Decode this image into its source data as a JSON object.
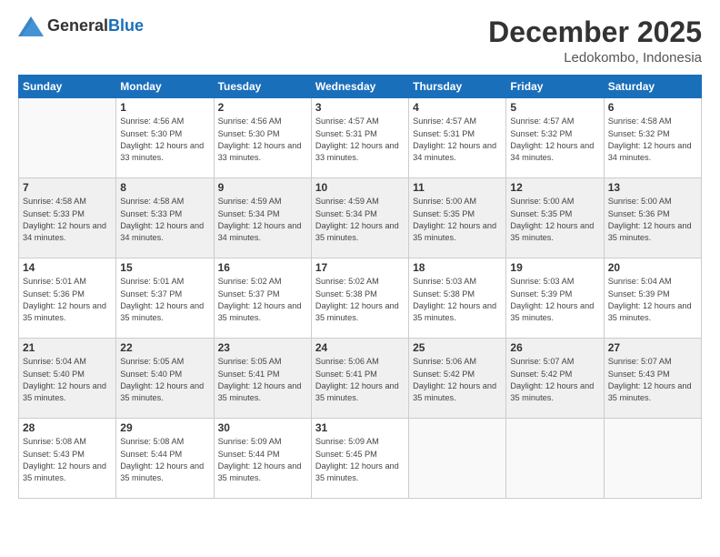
{
  "header": {
    "logo": {
      "general": "General",
      "blue": "Blue"
    },
    "title": "December 2025",
    "subtitle": "Ledokombo, Indonesia"
  },
  "calendar": {
    "headers": [
      "Sunday",
      "Monday",
      "Tuesday",
      "Wednesday",
      "Thursday",
      "Friday",
      "Saturday"
    ],
    "rows": [
      [
        {
          "date": "",
          "sunrise": "",
          "sunset": "",
          "daylight": ""
        },
        {
          "date": "1",
          "sunrise": "Sunrise: 4:56 AM",
          "sunset": "Sunset: 5:30 PM",
          "daylight": "Daylight: 12 hours and 33 minutes."
        },
        {
          "date": "2",
          "sunrise": "Sunrise: 4:56 AM",
          "sunset": "Sunset: 5:30 PM",
          "daylight": "Daylight: 12 hours and 33 minutes."
        },
        {
          "date": "3",
          "sunrise": "Sunrise: 4:57 AM",
          "sunset": "Sunset: 5:31 PM",
          "daylight": "Daylight: 12 hours and 33 minutes."
        },
        {
          "date": "4",
          "sunrise": "Sunrise: 4:57 AM",
          "sunset": "Sunset: 5:31 PM",
          "daylight": "Daylight: 12 hours and 34 minutes."
        },
        {
          "date": "5",
          "sunrise": "Sunrise: 4:57 AM",
          "sunset": "Sunset: 5:32 PM",
          "daylight": "Daylight: 12 hours and 34 minutes."
        },
        {
          "date": "6",
          "sunrise": "Sunrise: 4:58 AM",
          "sunset": "Sunset: 5:32 PM",
          "daylight": "Daylight: 12 hours and 34 minutes."
        }
      ],
      [
        {
          "date": "7",
          "sunrise": "Sunrise: 4:58 AM",
          "sunset": "Sunset: 5:33 PM",
          "daylight": "Daylight: 12 hours and 34 minutes."
        },
        {
          "date": "8",
          "sunrise": "Sunrise: 4:58 AM",
          "sunset": "Sunset: 5:33 PM",
          "daylight": "Daylight: 12 hours and 34 minutes."
        },
        {
          "date": "9",
          "sunrise": "Sunrise: 4:59 AM",
          "sunset": "Sunset: 5:34 PM",
          "daylight": "Daylight: 12 hours and 34 minutes."
        },
        {
          "date": "10",
          "sunrise": "Sunrise: 4:59 AM",
          "sunset": "Sunset: 5:34 PM",
          "daylight": "Daylight: 12 hours and 35 minutes."
        },
        {
          "date": "11",
          "sunrise": "Sunrise: 5:00 AM",
          "sunset": "Sunset: 5:35 PM",
          "daylight": "Daylight: 12 hours and 35 minutes."
        },
        {
          "date": "12",
          "sunrise": "Sunrise: 5:00 AM",
          "sunset": "Sunset: 5:35 PM",
          "daylight": "Daylight: 12 hours and 35 minutes."
        },
        {
          "date": "13",
          "sunrise": "Sunrise: 5:00 AM",
          "sunset": "Sunset: 5:36 PM",
          "daylight": "Daylight: 12 hours and 35 minutes."
        }
      ],
      [
        {
          "date": "14",
          "sunrise": "Sunrise: 5:01 AM",
          "sunset": "Sunset: 5:36 PM",
          "daylight": "Daylight: 12 hours and 35 minutes."
        },
        {
          "date": "15",
          "sunrise": "Sunrise: 5:01 AM",
          "sunset": "Sunset: 5:37 PM",
          "daylight": "Daylight: 12 hours and 35 minutes."
        },
        {
          "date": "16",
          "sunrise": "Sunrise: 5:02 AM",
          "sunset": "Sunset: 5:37 PM",
          "daylight": "Daylight: 12 hours and 35 minutes."
        },
        {
          "date": "17",
          "sunrise": "Sunrise: 5:02 AM",
          "sunset": "Sunset: 5:38 PM",
          "daylight": "Daylight: 12 hours and 35 minutes."
        },
        {
          "date": "18",
          "sunrise": "Sunrise: 5:03 AM",
          "sunset": "Sunset: 5:38 PM",
          "daylight": "Daylight: 12 hours and 35 minutes."
        },
        {
          "date": "19",
          "sunrise": "Sunrise: 5:03 AM",
          "sunset": "Sunset: 5:39 PM",
          "daylight": "Daylight: 12 hours and 35 minutes."
        },
        {
          "date": "20",
          "sunrise": "Sunrise: 5:04 AM",
          "sunset": "Sunset: 5:39 PM",
          "daylight": "Daylight: 12 hours and 35 minutes."
        }
      ],
      [
        {
          "date": "21",
          "sunrise": "Sunrise: 5:04 AM",
          "sunset": "Sunset: 5:40 PM",
          "daylight": "Daylight: 12 hours and 35 minutes."
        },
        {
          "date": "22",
          "sunrise": "Sunrise: 5:05 AM",
          "sunset": "Sunset: 5:40 PM",
          "daylight": "Daylight: 12 hours and 35 minutes."
        },
        {
          "date": "23",
          "sunrise": "Sunrise: 5:05 AM",
          "sunset": "Sunset: 5:41 PM",
          "daylight": "Daylight: 12 hours and 35 minutes."
        },
        {
          "date": "24",
          "sunrise": "Sunrise: 5:06 AM",
          "sunset": "Sunset: 5:41 PM",
          "daylight": "Daylight: 12 hours and 35 minutes."
        },
        {
          "date": "25",
          "sunrise": "Sunrise: 5:06 AM",
          "sunset": "Sunset: 5:42 PM",
          "daylight": "Daylight: 12 hours and 35 minutes."
        },
        {
          "date": "26",
          "sunrise": "Sunrise: 5:07 AM",
          "sunset": "Sunset: 5:42 PM",
          "daylight": "Daylight: 12 hours and 35 minutes."
        },
        {
          "date": "27",
          "sunrise": "Sunrise: 5:07 AM",
          "sunset": "Sunset: 5:43 PM",
          "daylight": "Daylight: 12 hours and 35 minutes."
        }
      ],
      [
        {
          "date": "28",
          "sunrise": "Sunrise: 5:08 AM",
          "sunset": "Sunset: 5:43 PM",
          "daylight": "Daylight: 12 hours and 35 minutes."
        },
        {
          "date": "29",
          "sunrise": "Sunrise: 5:08 AM",
          "sunset": "Sunset: 5:44 PM",
          "daylight": "Daylight: 12 hours and 35 minutes."
        },
        {
          "date": "30",
          "sunrise": "Sunrise: 5:09 AM",
          "sunset": "Sunset: 5:44 PM",
          "daylight": "Daylight: 12 hours and 35 minutes."
        },
        {
          "date": "31",
          "sunrise": "Sunrise: 5:09 AM",
          "sunset": "Sunset: 5:45 PM",
          "daylight": "Daylight: 12 hours and 35 minutes."
        },
        {
          "date": "",
          "sunrise": "",
          "sunset": "",
          "daylight": ""
        },
        {
          "date": "",
          "sunrise": "",
          "sunset": "",
          "daylight": ""
        },
        {
          "date": "",
          "sunrise": "",
          "sunset": "",
          "daylight": ""
        }
      ]
    ]
  }
}
